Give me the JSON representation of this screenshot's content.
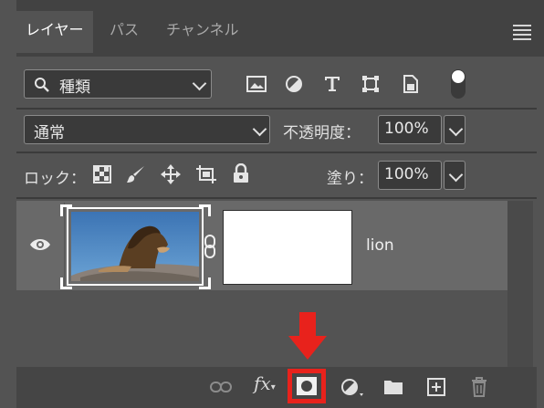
{
  "tabs": [
    {
      "label": "レイヤー",
      "active": true
    },
    {
      "label": "パス",
      "active": false
    },
    {
      "label": "チャンネル",
      "active": false
    }
  ],
  "filter": {
    "selected": "種類",
    "icons": [
      "image-filter-icon",
      "adjustment-filter-icon",
      "type-filter-icon",
      "shape-filter-icon",
      "smart-object-filter-icon",
      "filter-toggle-icon"
    ]
  },
  "blend": {
    "mode": "通常",
    "opacity_label": "不透明度：",
    "opacity_value": "100%"
  },
  "lock": {
    "label": "ロック：",
    "fill_label": "塗り：",
    "fill_value": "100%",
    "icons": [
      "lock-transparent-pixels-icon",
      "lock-image-pixels-icon",
      "lock-position-icon",
      "prevent-auto-nesting-icon",
      "lock-all-icon"
    ]
  },
  "layers": [
    {
      "name": "lion",
      "visible": true,
      "has_mask": true
    }
  ],
  "bottom_toolbar": {
    "icons": [
      "link-layers-icon",
      "layer-style-icon",
      "add-layer-mask-icon",
      "adjustment-layer-icon",
      "new-group-icon",
      "new-layer-icon",
      "delete-layer-icon"
    ],
    "highlighted": "add-layer-mask-icon"
  },
  "colors": {
    "highlight": "#e8221c",
    "panel": "#535353",
    "selected_row": "#696969"
  }
}
